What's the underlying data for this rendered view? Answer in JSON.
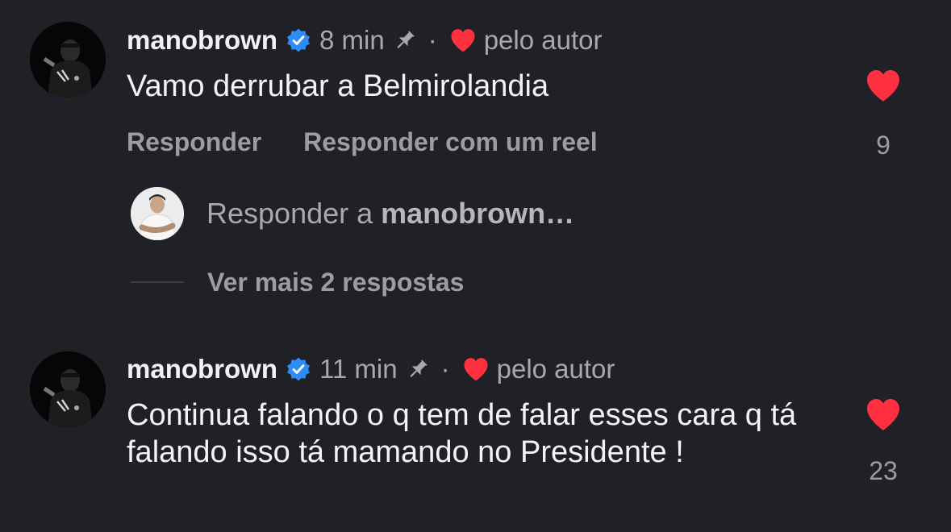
{
  "colors": {
    "background": "#202126",
    "text": "#f2f2f4",
    "secondary": "#a8a9b0",
    "verified_blue": "#2e8cf5",
    "heart_red": "#ff3040"
  },
  "comments": [
    {
      "username": "manobrown",
      "time": "8 min",
      "separator": "·",
      "liked_by_author": "pelo autor",
      "text": "Vamo derrubar a Belmirolandia",
      "actions": {
        "reply": "Responder",
        "reply_reel": "Responder com um reel"
      },
      "likes": "9",
      "reply_prompt_prefix": "Responder a ",
      "reply_prompt_user": "manobrown…",
      "more_replies": "Ver mais 2 respostas"
    },
    {
      "username": "manobrown",
      "time": "11 min",
      "separator": "·",
      "liked_by_author": "pelo autor",
      "text": "Continua falando o q tem de falar esses cara q tá falando isso tá mamando no Presidente !",
      "likes": "23"
    }
  ]
}
